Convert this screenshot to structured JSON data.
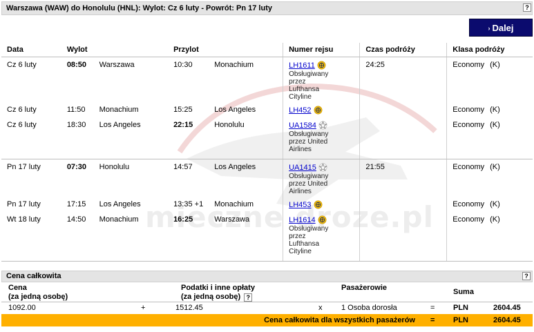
{
  "header": {
    "title": "Warszawa (WAW) do Honolulu (HNL): Wylot: Cz 6 luty  - Powrót: Pn 17 luty",
    "help": "?"
  },
  "next_button": {
    "label": "Dalej",
    "arrow": "›"
  },
  "watermark": "mieczne droze.pl",
  "columns": [
    "Data",
    "Wylot",
    "Przylot",
    "Numer rejsu",
    "Czas podróży",
    "Klasa podróży"
  ],
  "segments": [
    {
      "date": "Cz 6 luty",
      "dep_time": "08:50",
      "dep_bold": true,
      "dep_city": "Warszawa",
      "arr_time": "10:30",
      "arr_bold": false,
      "arr_city": "Monachium",
      "flight": "LH1611",
      "carrier": "lufthansa",
      "operated": [
        "Obsługiwany",
        "przez",
        "Lufthansa",
        "Cityline"
      ],
      "duration": "24:25",
      "class": "Economy",
      "code": "(K)"
    },
    {
      "date": "Cz 6 luty",
      "dep_time": "11:50",
      "dep_bold": false,
      "dep_city": "Monachium",
      "arr_time": "15:25",
      "arr_bold": false,
      "arr_city": "Los Angeles",
      "flight": "LH452",
      "carrier": "lufthansa",
      "operated": [],
      "duration": "",
      "class": "Economy",
      "code": "(K)"
    },
    {
      "date": "Cz 6 luty",
      "dep_time": "18:30",
      "dep_bold": false,
      "dep_city": "Los Angeles",
      "arr_time": "22:15",
      "arr_bold": true,
      "arr_city": "Honolulu",
      "flight": "UA1584",
      "carrier": "united",
      "operated": [
        "Obsługiwany",
        "przez United",
        "Airlines"
      ],
      "duration": "",
      "class": "Economy",
      "code": "(K)"
    },
    {
      "date": "Pn 17 luty",
      "dep_time": "07:30",
      "dep_bold": true,
      "dep_city": "Honolulu",
      "arr_time": "14:57",
      "arr_bold": false,
      "arr_city": "Los Angeles",
      "flight": "UA1415",
      "carrier": "united",
      "operated": [
        "Obsługiwany",
        "przez United",
        "Airlines"
      ],
      "duration": "21:55",
      "class": "Economy",
      "code": "(K)"
    },
    {
      "date": "Pn 17 luty",
      "dep_time": "17:15",
      "dep_bold": false,
      "dep_city": "Los Angeles",
      "arr_time": "13:35 +1",
      "arr_bold": false,
      "arr_city": "Monachium",
      "flight": "LH453",
      "carrier": "lufthansa",
      "operated": [],
      "duration": "",
      "class": "Economy",
      "code": "(K)"
    },
    {
      "date": "Wt 18 luty",
      "dep_time": "14:50",
      "dep_bold": false,
      "dep_city": "Monachium",
      "arr_time": "16:25",
      "arr_bold": true,
      "arr_city": "Warszawa",
      "flight": "LH1614",
      "carrier": "lufthansa",
      "operated": [
        "Obsługiwany",
        "przez",
        "Lufthansa",
        "Cityline"
      ],
      "duration": "",
      "class": "Economy",
      "code": "(K)"
    }
  ],
  "price": {
    "section_title": "Cena całkowita",
    "help": "?",
    "col_price": "Cena",
    "col_price_sub": "(za jedną osobę)",
    "col_taxes": "Podatki i inne opłaty",
    "col_taxes_sub": "(za jedną osobę)",
    "taxes_help": "?",
    "col_pax": "Pasażerowie",
    "col_sum": "Suma",
    "base_price": "1092.00",
    "plus": "+",
    "taxes": "1512.45",
    "times": "x",
    "pax": "1  Osoba dorosła",
    "equals": "=",
    "currency": "PLN",
    "sum": "2604.45",
    "total_label": "Cena całkowita dla wszystkich pasażerów",
    "total_equals": "=",
    "total_currency": "PLN",
    "total_sum": "2604.45"
  },
  "colors": {
    "title_bar": "#e4e4e4",
    "button": "#0b0b6e",
    "total_bar": "#ffb000",
    "link": "#0000cc"
  }
}
